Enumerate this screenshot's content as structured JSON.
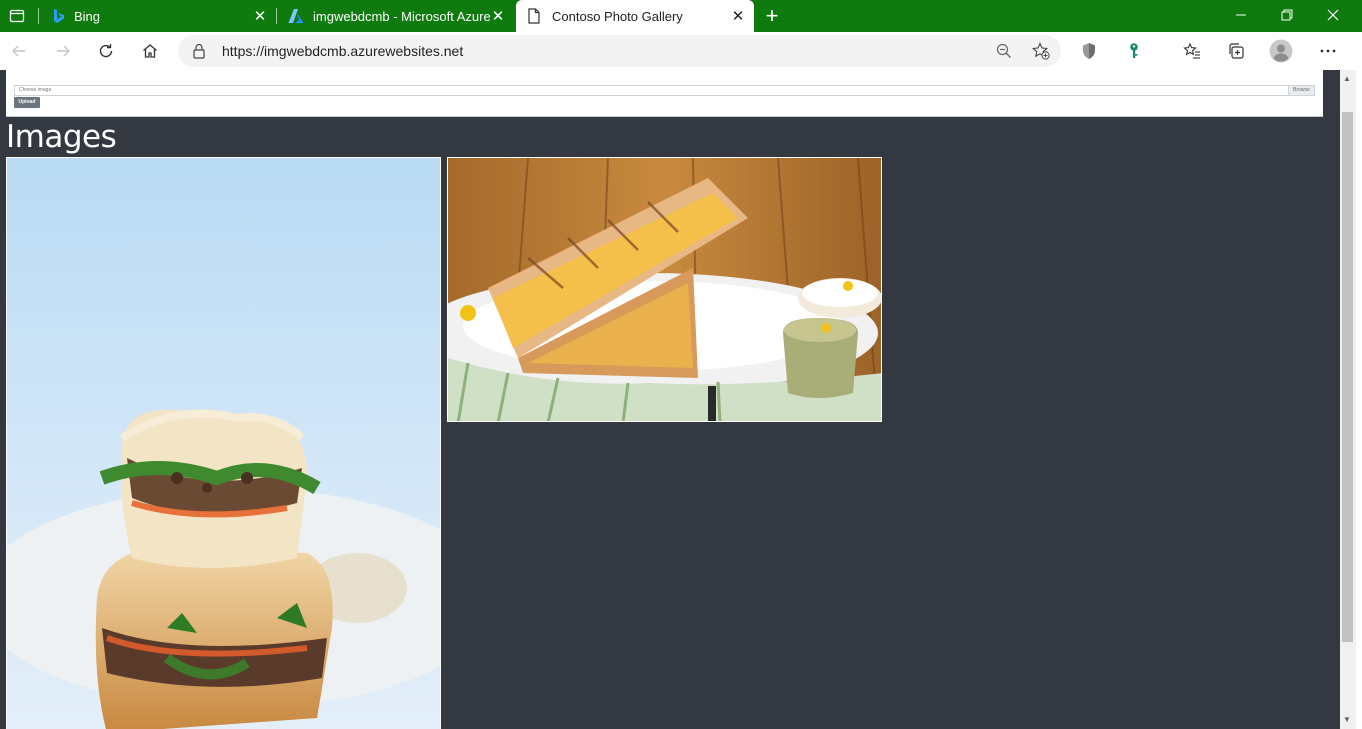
{
  "browser": {
    "tabs": [
      {
        "label": "Bing",
        "icon": "bing-icon",
        "active": false
      },
      {
        "label": "imgwebdcmb - Microsoft Azure",
        "icon": "azure-icon",
        "active": false
      },
      {
        "label": "Contoso Photo Gallery",
        "icon": "page-icon",
        "active": true
      }
    ],
    "new_tab_label": "+",
    "address": {
      "url": "https://imgwebdcmb.azurewebsites.net"
    },
    "accent_color": "#0f7b0f"
  },
  "upload": {
    "file_placeholder": "Choose image",
    "browse_label": "Browse",
    "upload_label": "Upload"
  },
  "gallery": {
    "title": "Images",
    "images": [
      {
        "subject": "stacked banh mi sandwich on blue background"
      },
      {
        "subject": "grilled sandwich with dips on plate"
      }
    ]
  }
}
